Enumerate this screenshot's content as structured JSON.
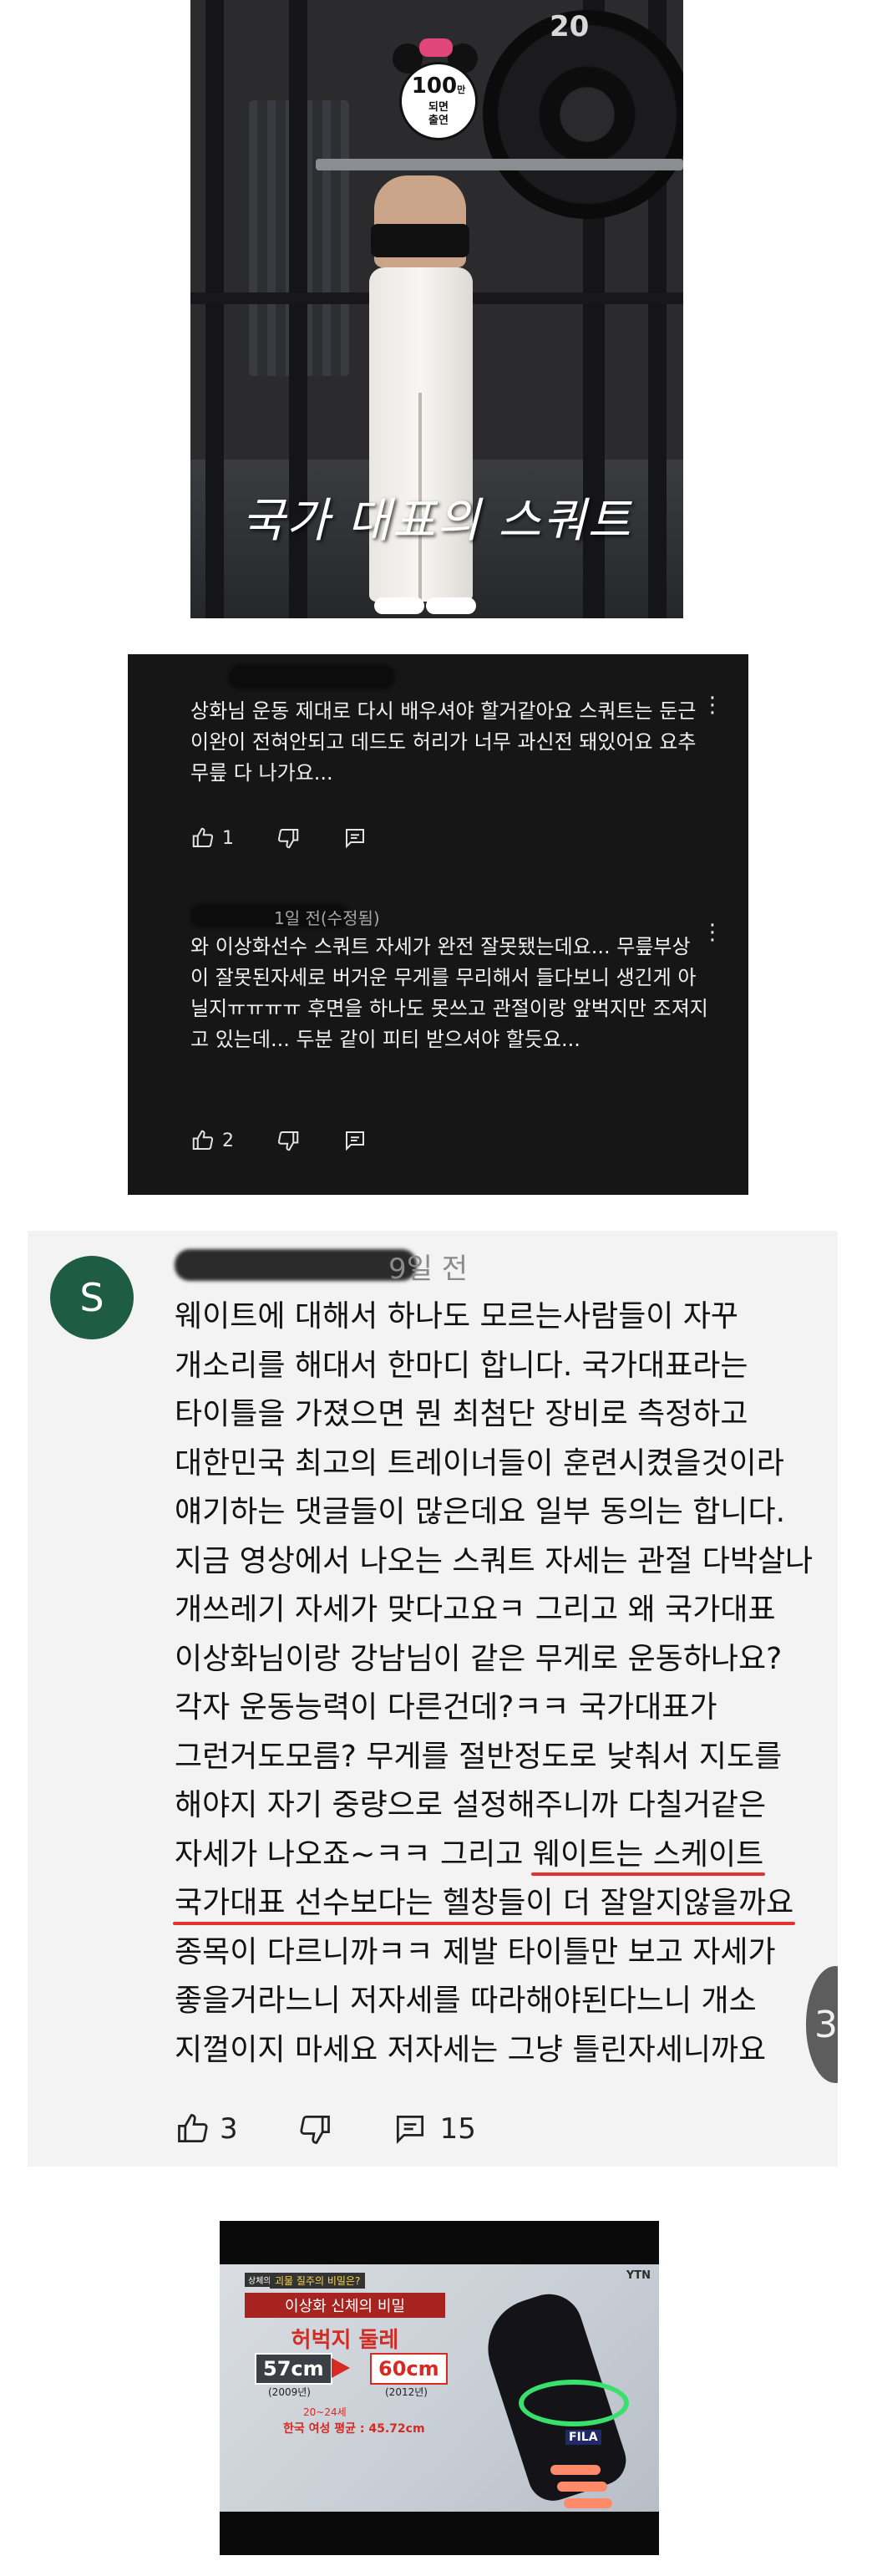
{
  "top_thumbnail": {
    "caption": "국가 대표의 스쿼트",
    "plate_number": "20",
    "sticker": {
      "big": "100",
      "big_unit": "만",
      "line1": "되면",
      "line2": "출연"
    }
  },
  "dark_comments": [
    {
      "meta": "",
      "text": "상화님 운동 제대로 다시 배우셔야 할거같아요 스쿼트는 둔근 이완이 전혀안되고 데드도 허리가 너무 과신전 돼있어요 요추 무릎 다 나가요...",
      "likes": "1",
      "menu": "⋮"
    },
    {
      "meta": "1일 전(수정됨)",
      "text": "와 이상화선수 스쿼트 자세가 완전 잘못됐는데요... 무릎부상이 잘못된자세로 버거운 무게를 무리해서 들다보니 생긴게 아닐지ㅠㅠㅠㅠ 후면을 하나도 못쓰고 관절이랑 앞벅지만 조져지고 있는데... 두분 같이 피티 받으셔야 할듯요...",
      "likes": "2",
      "menu": "⋮"
    }
  ],
  "big_comment": {
    "avatar_letter": "S",
    "time_ago": "9일 전",
    "lines": [
      "웨이트에 대해서 하나도 모르는사람들이 자꾸",
      "개소리를 해대서 한마디 합니다. 국가대표라는",
      "타이틀을 가졌으면 뭔 최첨단 장비로 측정하고",
      "대한민국 최고의 트레이너들이 훈련시켰을것이라",
      "얘기하는 댓글들이 많은데요 일부 동의는 합니다.",
      "지금 영상에서 나오는 스쿼트 자세는 관절 다박살나",
      "개쓰레기 자세가 맞다고요ㅋ 그리고 왜 국가대표",
      "이상화님이랑 강남님이 같은 무게로 운동하나요?",
      "각자 운동능력이 다른건데?ㅋㅋ 국가대표가",
      "그런거도모름? 무게를 절반정도로 낮춰서 지도를",
      "해야지 자기 중량으로 설정해주니까 다칠거같은"
    ],
    "line12_plain": "자세가 나오죠~ㅋㅋ 그리고 ",
    "line12_highlight": "웨이트는 스케이트",
    "line13_highlight": "국가대표 선수보다는 헬창들이 더 잘알지않을까요",
    "lines_after": [
      "종목이 다르니까ㅋㅋ 제발 타이틀만 보고 자세가",
      "좋을거라느니 저자세를 따라해야된다느니 개소",
      "지껄이지 마세요 저자세는 그냥 틀린자세니까요"
    ],
    "likes": "3",
    "replies": "15",
    "side_button": "3"
  },
  "bottom_thumbnail": {
    "tag_small": "상체의",
    "tag_question": "괴물 질주의 비밀은?",
    "headline": "이상화 신체의 비밀",
    "subtitle": "허벅지 둘레",
    "value_before": "57cm",
    "value_after": "60cm",
    "year_before": "(2009년)",
    "year_after": "(2012년)",
    "age_note": "20~24세",
    "average_note": "한국 여성 평균 : 45.72cm",
    "broadcaster": "YTN",
    "brand": "FILA"
  },
  "colors": {
    "dark_card_bg": "#161616",
    "light_card_bg": "#f3f3f3",
    "avatar_bg": "#1f5c45",
    "highlight_underline": "#e3322e",
    "broadcast_red": "#d62a23"
  },
  "icons": [
    "thumbs-up-icon",
    "thumbs-down-icon",
    "reply-icon",
    "more-vert-icon"
  ]
}
